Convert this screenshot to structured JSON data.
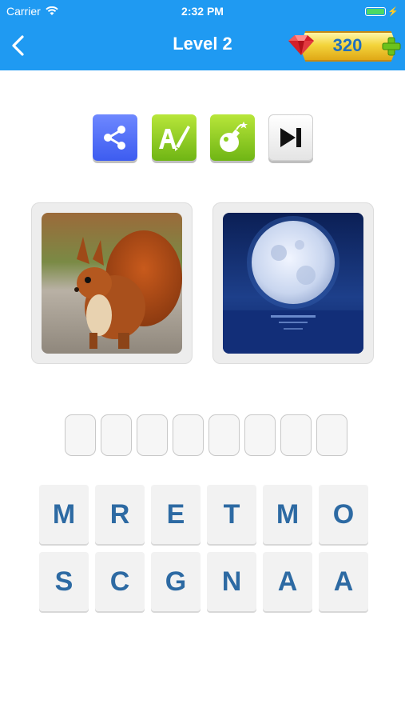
{
  "status_bar": {
    "carrier": "Carrier",
    "time": "2:32 PM"
  },
  "nav": {
    "title": "Level 2",
    "coins": "320"
  },
  "toolbar": {
    "icons": [
      "share-icon",
      "reveal-letter-icon",
      "bomb-icon",
      "skip-icon"
    ]
  },
  "pictures": [
    {
      "subject": "squirrel"
    },
    {
      "subject": "moon"
    }
  ],
  "answer": {
    "slot_count": 8
  },
  "letters": {
    "row1": [
      "M",
      "R",
      "E",
      "T",
      "M",
      "O"
    ],
    "row2": [
      "S",
      "C",
      "G",
      "N",
      "A",
      "A"
    ]
  },
  "colors": {
    "header": "#1f9af2",
    "tile_text": "#2d6aa3",
    "share_button": "#4a67f5",
    "green_button": "#8ccf21"
  }
}
